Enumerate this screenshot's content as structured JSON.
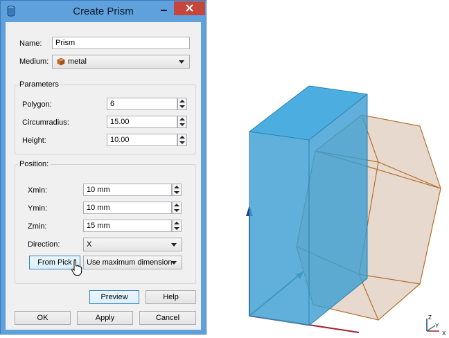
{
  "dialog": {
    "title": "Create Prism",
    "name_label": "Name:",
    "name_value": "Prism",
    "medium_label": "Medium:",
    "medium_value": "metal",
    "parameters_group": "Parameters",
    "polygon_label": "Polygon:",
    "polygon_value": "6",
    "circumradius_label": "Circumradius:",
    "circumradius_value": "15.00",
    "height_label": "Height:",
    "height_value": "10.00",
    "position_group": "Position:",
    "xmin_label": "Xmin:",
    "xmin_value": "10 mm",
    "ymin_label": "Ymin:",
    "ymin_value": "10 mm",
    "zmin_label": "Zmin:",
    "zmin_value": "15 mm",
    "direction_label": "Direction:",
    "direction_value": "X",
    "from_pick_label": "From Pick",
    "dimension_value": "Use maximum dimension",
    "preview_label": "Preview",
    "help_label": "Help",
    "ok_label": "OK",
    "apply_label": "Apply",
    "cancel_label": "Cancel"
  },
  "triad": {
    "z": "Z",
    "y": "Y",
    "x": "X"
  },
  "colors": {
    "title_bar": "#5fa1dc",
    "close_button": "#c7463b",
    "box_fill": "#3d9fd3",
    "prism_fill": "#e3d2c4",
    "prism_edge": "#b5702d",
    "axis_z": "#283c8c",
    "axis_x": "#9b2030",
    "axis_y": "#2c8a64"
  }
}
